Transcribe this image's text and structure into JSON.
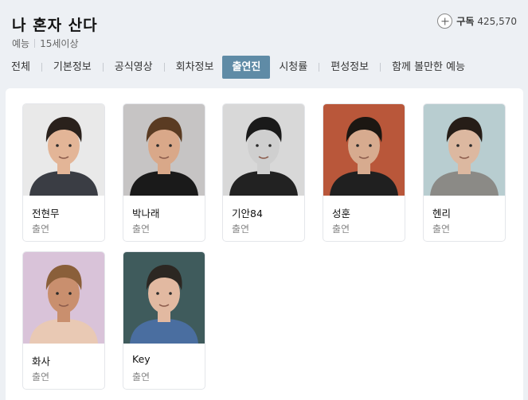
{
  "program": {
    "title": "나 혼자 산다",
    "genre": "예능",
    "rating": "15세이상"
  },
  "subscribe": {
    "label": "구독",
    "count": "425,570"
  },
  "tabs": [
    "전체",
    "기본정보",
    "공식영상",
    "회차정보",
    "출연진",
    "시청률",
    "편성정보",
    "함께 볼만한 예능"
  ],
  "active_tab": "출연진",
  "cast": [
    {
      "name": "전현무",
      "role": "출연",
      "bg": "#e9e9e9",
      "hair": "#2a211c",
      "skin": "#e3b597",
      "shirt": "#3a3d44"
    },
    {
      "name": "박나래",
      "role": "출연",
      "bg": "#c6c4c4",
      "hair": "#5a3b22",
      "skin": "#d9a889",
      "shirt": "#1a1a1a"
    },
    {
      "name": "기안84",
      "role": "출연",
      "bg": "#d8d8d8",
      "hair": "#1a1a1a",
      "skin": "#cfcfcf",
      "shirt": "#222222"
    },
    {
      "name": "성훈",
      "role": "출연",
      "bg": "#b9573a",
      "hair": "#1c1712",
      "skin": "#d7ab8f",
      "shirt": "#202020"
    },
    {
      "name": "헨리",
      "role": "출연",
      "bg": "#b8cdd0",
      "hair": "#261d17",
      "skin": "#dcb8a0",
      "shirt": "#8b8a86"
    },
    {
      "name": "화사",
      "role": "출연",
      "bg": "#d9c3d9",
      "hair": "#8a5f3a",
      "skin": "#c98f6e",
      "shirt": "#e9c9b4"
    },
    {
      "name": "Key",
      "role": "출연",
      "bg": "#3f5b5c",
      "hair": "#2c2722",
      "skin": "#e2b9a1",
      "shirt": "#4a6ea0"
    }
  ]
}
